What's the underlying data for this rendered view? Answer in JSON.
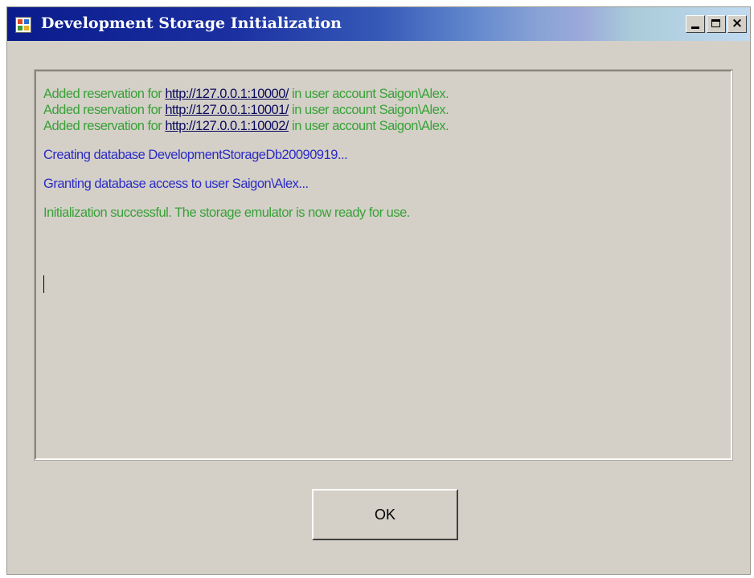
{
  "window": {
    "title": "Development Storage Initialization",
    "app_icon": "app-window-icon",
    "controls": {
      "minimize_icon": "minimize-icon",
      "maximize_icon": "maximize-icon",
      "close_symbol": "×"
    }
  },
  "log": {
    "reservation_prefix": "Added reservation for",
    "reservation_suffix": "in user account Saigon\\Alex.",
    "reservations": [
      "http://127.0.0.1:10000/",
      "http://127.0.0.1:10001/",
      "http://127.0.0.1:10002/"
    ],
    "creating": "Creating database DevelopmentStorageDb20090919...",
    "granting": "Granting database access to user Saigon\\Alex...",
    "success": "Initialization successful. The storage emulator is now ready for use."
  },
  "buttons": {
    "ok_label": "OK"
  },
  "colors": {
    "success_text": "#38a137",
    "info_text": "#2c2cc4",
    "link_text": "#0b0b5e",
    "window_face": "#d4d0c8"
  }
}
